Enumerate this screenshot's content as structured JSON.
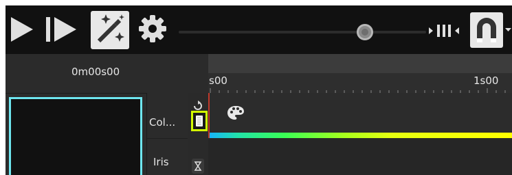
{
  "toolbar": {
    "play": "play-icon",
    "step": "step-forward-icon",
    "magic": "magic-wand-icon",
    "settings": "gear-icon",
    "zoom_slider": "zoom-slider",
    "snap": "snap-icon",
    "magnet": "magnet-icon"
  },
  "header": {
    "timecode": "0m00s00",
    "ruler_ticks": [
      "s00",
      "1s00"
    ]
  },
  "rows": [
    {
      "label": "Col...",
      "icon": "palette-icon"
    },
    {
      "label": "Iris",
      "icon": "iris-icon"
    }
  ],
  "colors": {
    "thumbnail_border": "#6ee6f0",
    "highlight": "#d4ff00",
    "playhead": "#c0392b"
  }
}
